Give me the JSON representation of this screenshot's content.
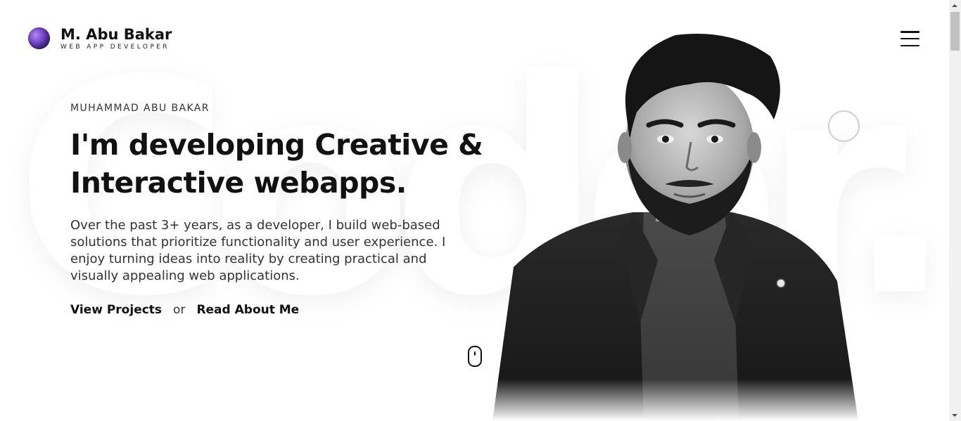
{
  "header": {
    "brand_name": "M. Abu Bakar",
    "brand_role": "WEB APP DEVELOPER",
    "menu_icon": "hamburger-menu-icon"
  },
  "hero": {
    "eyebrow": "MUHAMMAD ABU BAKAR",
    "headline_line1": "I'm developing Creative &",
    "headline_line2": "Interactive webapps.",
    "lead": "Over the past 3+ years, as a developer, I build web-based solutions that prioritize functionality and user experience. I enjoy turning ideas into reality by creating practical and visually appealing web applications.",
    "cta_primary": "View Projects",
    "cta_separator": "or",
    "cta_secondary": "Read About Me"
  },
  "background": {
    "watermark_word": "Coder."
  },
  "scroll_indicator_icon": "mouse-scroll-icon",
  "colors": {
    "text": "#111111",
    "muted": "#333333",
    "background": "#ffffff",
    "accent_logo": "#7a4ad0"
  }
}
